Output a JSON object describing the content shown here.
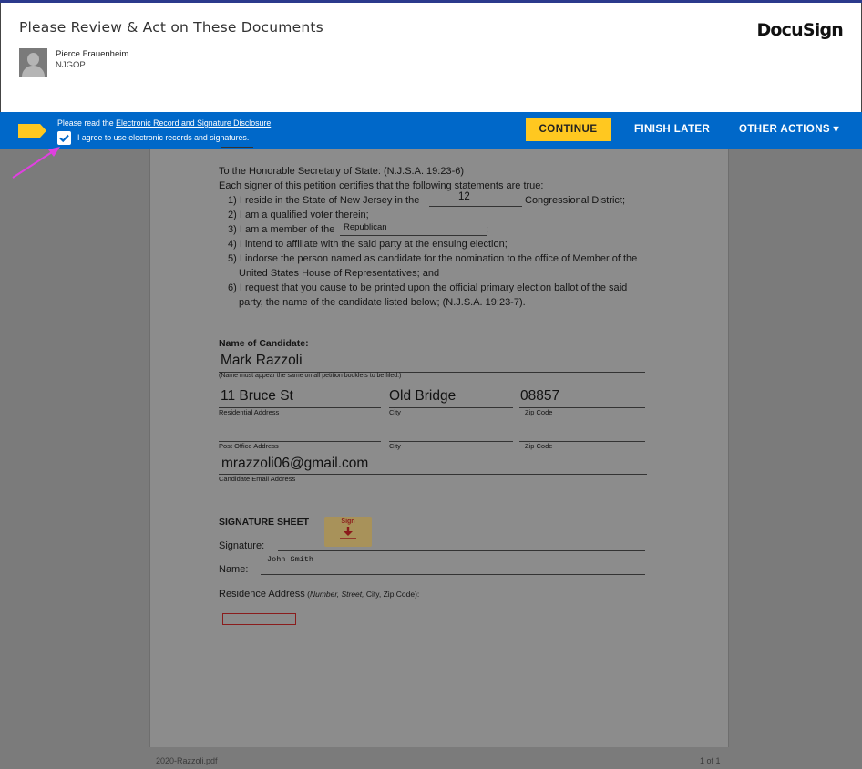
{
  "header": {
    "title": "Please Review & Act on These Documents",
    "sender_name": "Pierce Frauenheim",
    "sender_org": "NJGOP",
    "brand": "DocuSign"
  },
  "actionbar": {
    "disclosure_prefix": "Please read the ",
    "disclosure_link": "Electronic Record and Signature Disclosure",
    "disclosure_suffix": ".",
    "agree_checked": true,
    "agree_label": "I agree to use electronic records and signatures.",
    "continue_label": "CONTINUE",
    "finish_later_label": "FINISH LATER",
    "other_actions_label": "OTHER ACTIONS ▾",
    "accent_color": "#0068c9",
    "continue_color": "#ffc820"
  },
  "document": {
    "intro_line": "To the Honorable Secretary of State:   (N.J.S.A. 19:23-6)",
    "certifies_line": "Each signer of this petition certifies that the following statements are true:",
    "stmt1_a": "1) I reside in the State of New Jersey in the",
    "stmt1_b": "Congressional District;",
    "district_value": "12",
    "stmt2": "2) I am a qualified voter therein;",
    "stmt3_a": "3) I am a member of the",
    "stmt3_b": ";",
    "party_value": "Republican",
    "stmt4": "4) I intend to affiliate with the said party at the ensuing election;",
    "stmt5_a": "5) I indorse the person named as candidate for the nomination to the office of Member of the",
    "stmt5_b": "United States House of Representatives; and",
    "stmt6_a": "6) I request that you cause to be printed upon the official primary election ballot of the said",
    "stmt6_b": "party, the name of the candidate listed below; (N.J.S.A. 19:23-7).",
    "candidate_heading": "Name of Candidate:",
    "candidate_name": "Mark Razzoli",
    "candidate_note": "(Name must appear the same on all petition booklets to be filed.)",
    "street_value": "11 Bruce St",
    "city_value": "Old Bridge",
    "zip_value": "08857",
    "residential_label": "Residential Address",
    "city_label": "City",
    "zip_label": "Zip Code",
    "po_label": "Post Office Address",
    "po_city_label": "City",
    "po_zip_label": "Zip Code",
    "email_value": "mrazzoli06@gmail.com",
    "email_label": "Candidate Email Address",
    "signature_heading": "SIGNATURE SHEET",
    "sign_tab_label": "Sign",
    "signature_label": "Signature:",
    "name_label": "Name:",
    "name_value": "John Smith",
    "residence_label": "Residence Address",
    "residence_hint_open": " (",
    "residence_hint_italic": "Number, Street,",
    "residence_hint_rest": " City, Zip Code):"
  },
  "footer": {
    "filename": "2020-Razzoli.pdf",
    "page_count": "1 of 1"
  }
}
